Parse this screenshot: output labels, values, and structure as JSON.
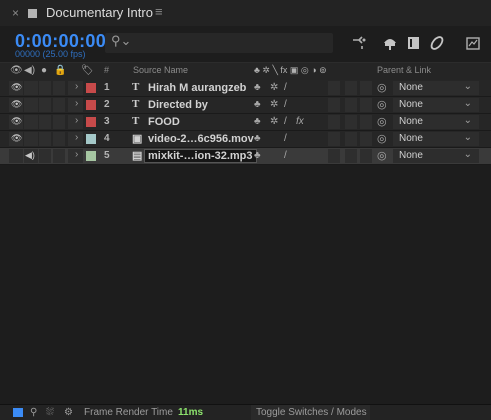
{
  "tab": {
    "title": "Documentary Intro",
    "close": "×",
    "menu": "≡",
    "swatch_color": "#b4b4b4"
  },
  "timecode": {
    "value": "0:00:00:00",
    "sub": "00000 (25.00 fps)"
  },
  "search": {
    "placeholder": "",
    "icon": "search-icon"
  },
  "toolbar_icons": [
    "comp-flowchart-icon",
    "shy-layers-icon",
    "frame-blending-icon",
    "motion-blur-icon",
    "graph-editor-icon"
  ],
  "columns": {
    "label_sym": "#",
    "source_name": "Source Name",
    "switches": "♣ ✲ ╲ fx ▣ ◎ ◑ ⊚",
    "parent_link": "Parent & Link"
  },
  "layers": [
    {
      "num": "1",
      "type": "T",
      "name": "Hirah M aurangzeb",
      "label_color": "#c74a4a",
      "switch_a": "♣",
      "switch_b": "✲",
      "switch_c": "/",
      "switch_fx": "",
      "parent": "None",
      "selected": false,
      "video": true,
      "audio": false
    },
    {
      "num": "2",
      "type": "T",
      "name": "Directed by",
      "label_color": "#c74a4a",
      "switch_a": "♣",
      "switch_b": "✲",
      "switch_c": "/",
      "switch_fx": "",
      "parent": "None",
      "selected": false,
      "video": true,
      "audio": false
    },
    {
      "num": "3",
      "type": "T",
      "name": "FOOD",
      "label_color": "#c74a4a",
      "switch_a": "♣",
      "switch_b": "✲",
      "switch_c": "/",
      "switch_fx": "fx",
      "parent": "None",
      "selected": false,
      "video": true,
      "audio": false
    },
    {
      "num": "4",
      "type": "▣",
      "name": "video-2…6c956.mov",
      "label_color": "#a4c8c8",
      "switch_a": "♣",
      "switch_b": "",
      "switch_c": "/",
      "switch_fx": "",
      "parent": "None",
      "selected": false,
      "video": true,
      "audio": false
    },
    {
      "num": "5",
      "type": "▤",
      "name": "mixkit-…ion-32.mp3",
      "label_color": "#a6c6a2",
      "switch_a": "♣",
      "switch_b": "",
      "switch_c": "/",
      "switch_fx": "",
      "parent": "None",
      "selected": true,
      "video": false,
      "audio": true
    }
  ],
  "footer": {
    "frame_render_label": "Frame Render Time",
    "frame_render_value": "11ms",
    "toggle_label": "Toggle Switches / Modes"
  }
}
